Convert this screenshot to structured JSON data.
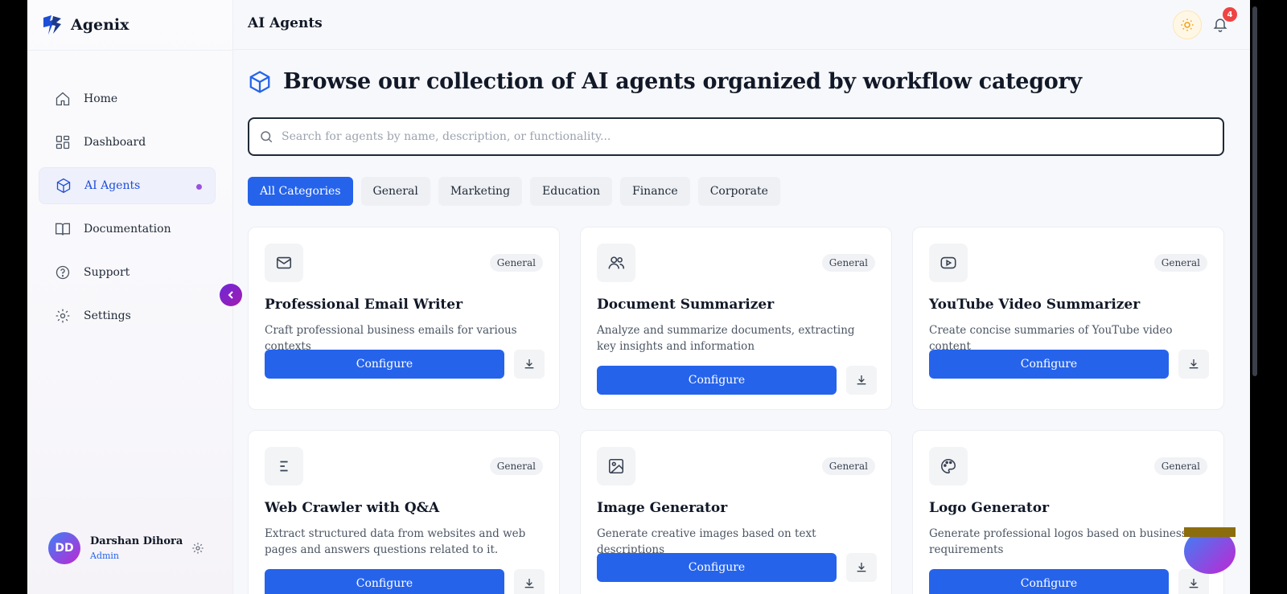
{
  "brand": {
    "name": "Agenix"
  },
  "sidebar": {
    "items": [
      {
        "label": "Home",
        "icon": "home-icon",
        "active": false
      },
      {
        "label": "Dashboard",
        "icon": "dashboard-icon",
        "active": false
      },
      {
        "label": "AI Agents",
        "icon": "cube-icon",
        "active": true
      },
      {
        "label": "Documentation",
        "icon": "book-icon",
        "active": false
      },
      {
        "label": "Support",
        "icon": "help-circle-icon",
        "active": false
      },
      {
        "label": "Settings",
        "icon": "gear-icon",
        "active": false
      }
    ],
    "collapse_icon": "chevron-left-icon"
  },
  "user": {
    "initials": "DD",
    "name": "Darshan Dihora",
    "role": "Admin"
  },
  "topbar": {
    "title": "AI Agents",
    "notification_count": "4",
    "theme_icon": "sun-icon",
    "bell_icon": "bell-icon"
  },
  "main": {
    "heading": "Browse our collection of AI agents organized by workflow category",
    "search": {
      "placeholder": "Search for agents by name, description, or functionality..."
    },
    "filters": [
      "All Categories",
      "General",
      "Marketing",
      "Education",
      "Finance",
      "Corporate"
    ],
    "active_filter": "All Categories",
    "cards": [
      {
        "icon": "mail-icon",
        "badge": "General",
        "title": "Professional Email Writer",
        "description": "Craft professional business emails for various contexts",
        "button": "Configure"
      },
      {
        "icon": "users-icon",
        "badge": "General",
        "title": "Document Summarizer",
        "description": "Analyze and summarize documents, extracting key insights and information",
        "button": "Configure"
      },
      {
        "icon": "youtube-icon",
        "badge": "General",
        "title": "YouTube Video Summarizer",
        "description": "Create concise summaries of YouTube video content",
        "button": "Configure"
      },
      {
        "icon": "text-align-icon",
        "badge": "General",
        "title": "Web Crawler with Q&A",
        "description": "Extract structured data from websites and web pages and answers questions related to it.",
        "button": "Configure"
      },
      {
        "icon": "image-icon",
        "badge": "General",
        "title": "Image Generator",
        "description": "Generate creative images based on text descriptions",
        "button": "Configure"
      },
      {
        "icon": "palette-icon",
        "badge": "General",
        "title": "Logo Generator",
        "description": "Generate professional logos based on business requirements",
        "button": "Configure"
      }
    ]
  },
  "colors": {
    "accent": "#2563eb",
    "badge_red": "#ef4444",
    "active_dot": "#9b51e0"
  }
}
